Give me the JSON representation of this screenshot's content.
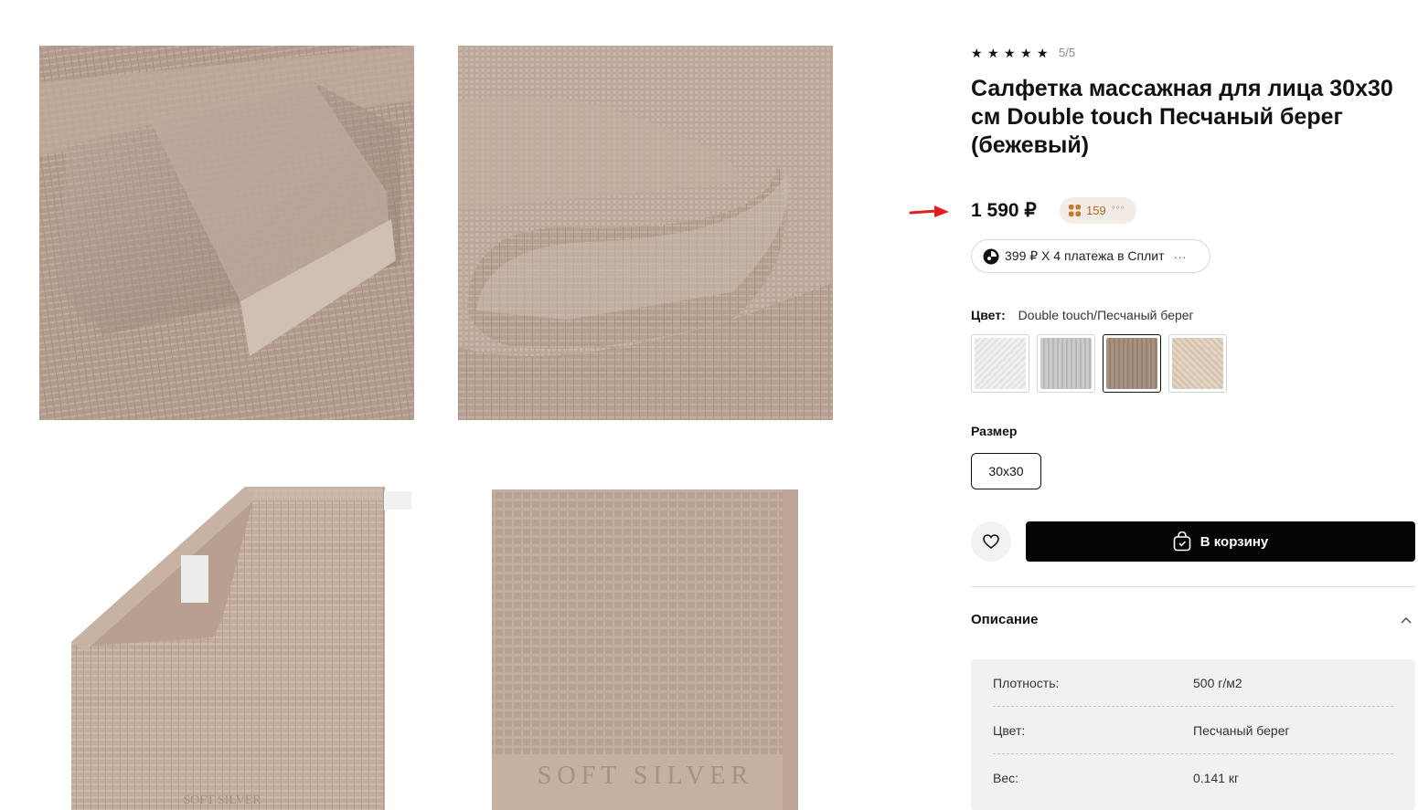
{
  "product": {
    "rating_value": "5/5",
    "stars": 5,
    "title": "Салфетка массажная для лица 30х30 см Double touch Песчаный берег (бежевый)",
    "price": "1 590 ₽",
    "bonus_points": "159",
    "split_text": "399 ₽ X 4 платежа в Сплит",
    "split_more": "···",
    "color_label": "Цвет:",
    "color_value": "Double touch/Песчаный берег",
    "swatches": [
      {
        "name": "white",
        "color": "#eceeef",
        "selected": false
      },
      {
        "name": "grey",
        "color": "#c6c7c8",
        "selected": false
      },
      {
        "name": "sand",
        "color": "#a8907f",
        "selected": true
      },
      {
        "name": "beige",
        "color": "#ddcdbb",
        "selected": false
      }
    ],
    "size_label": "Размер",
    "size_value": "30x30",
    "cart_label": "В корзину",
    "description_label": "Описание",
    "specs": [
      {
        "key": "Плотность:",
        "value": "500 г/м2"
      },
      {
        "key": "Цвет:",
        "value": "Песчаный берег"
      },
      {
        "key": "Вес:",
        "value": "0.141 кг"
      }
    ]
  },
  "gallery": {
    "brand_mark": "SOFT SILVER",
    "towel_color": "#c1aa9c"
  },
  "colors": {
    "accent_arrow": "#e02020",
    "bonus_text": "#b3671f",
    "cart_bg": "#050505"
  }
}
